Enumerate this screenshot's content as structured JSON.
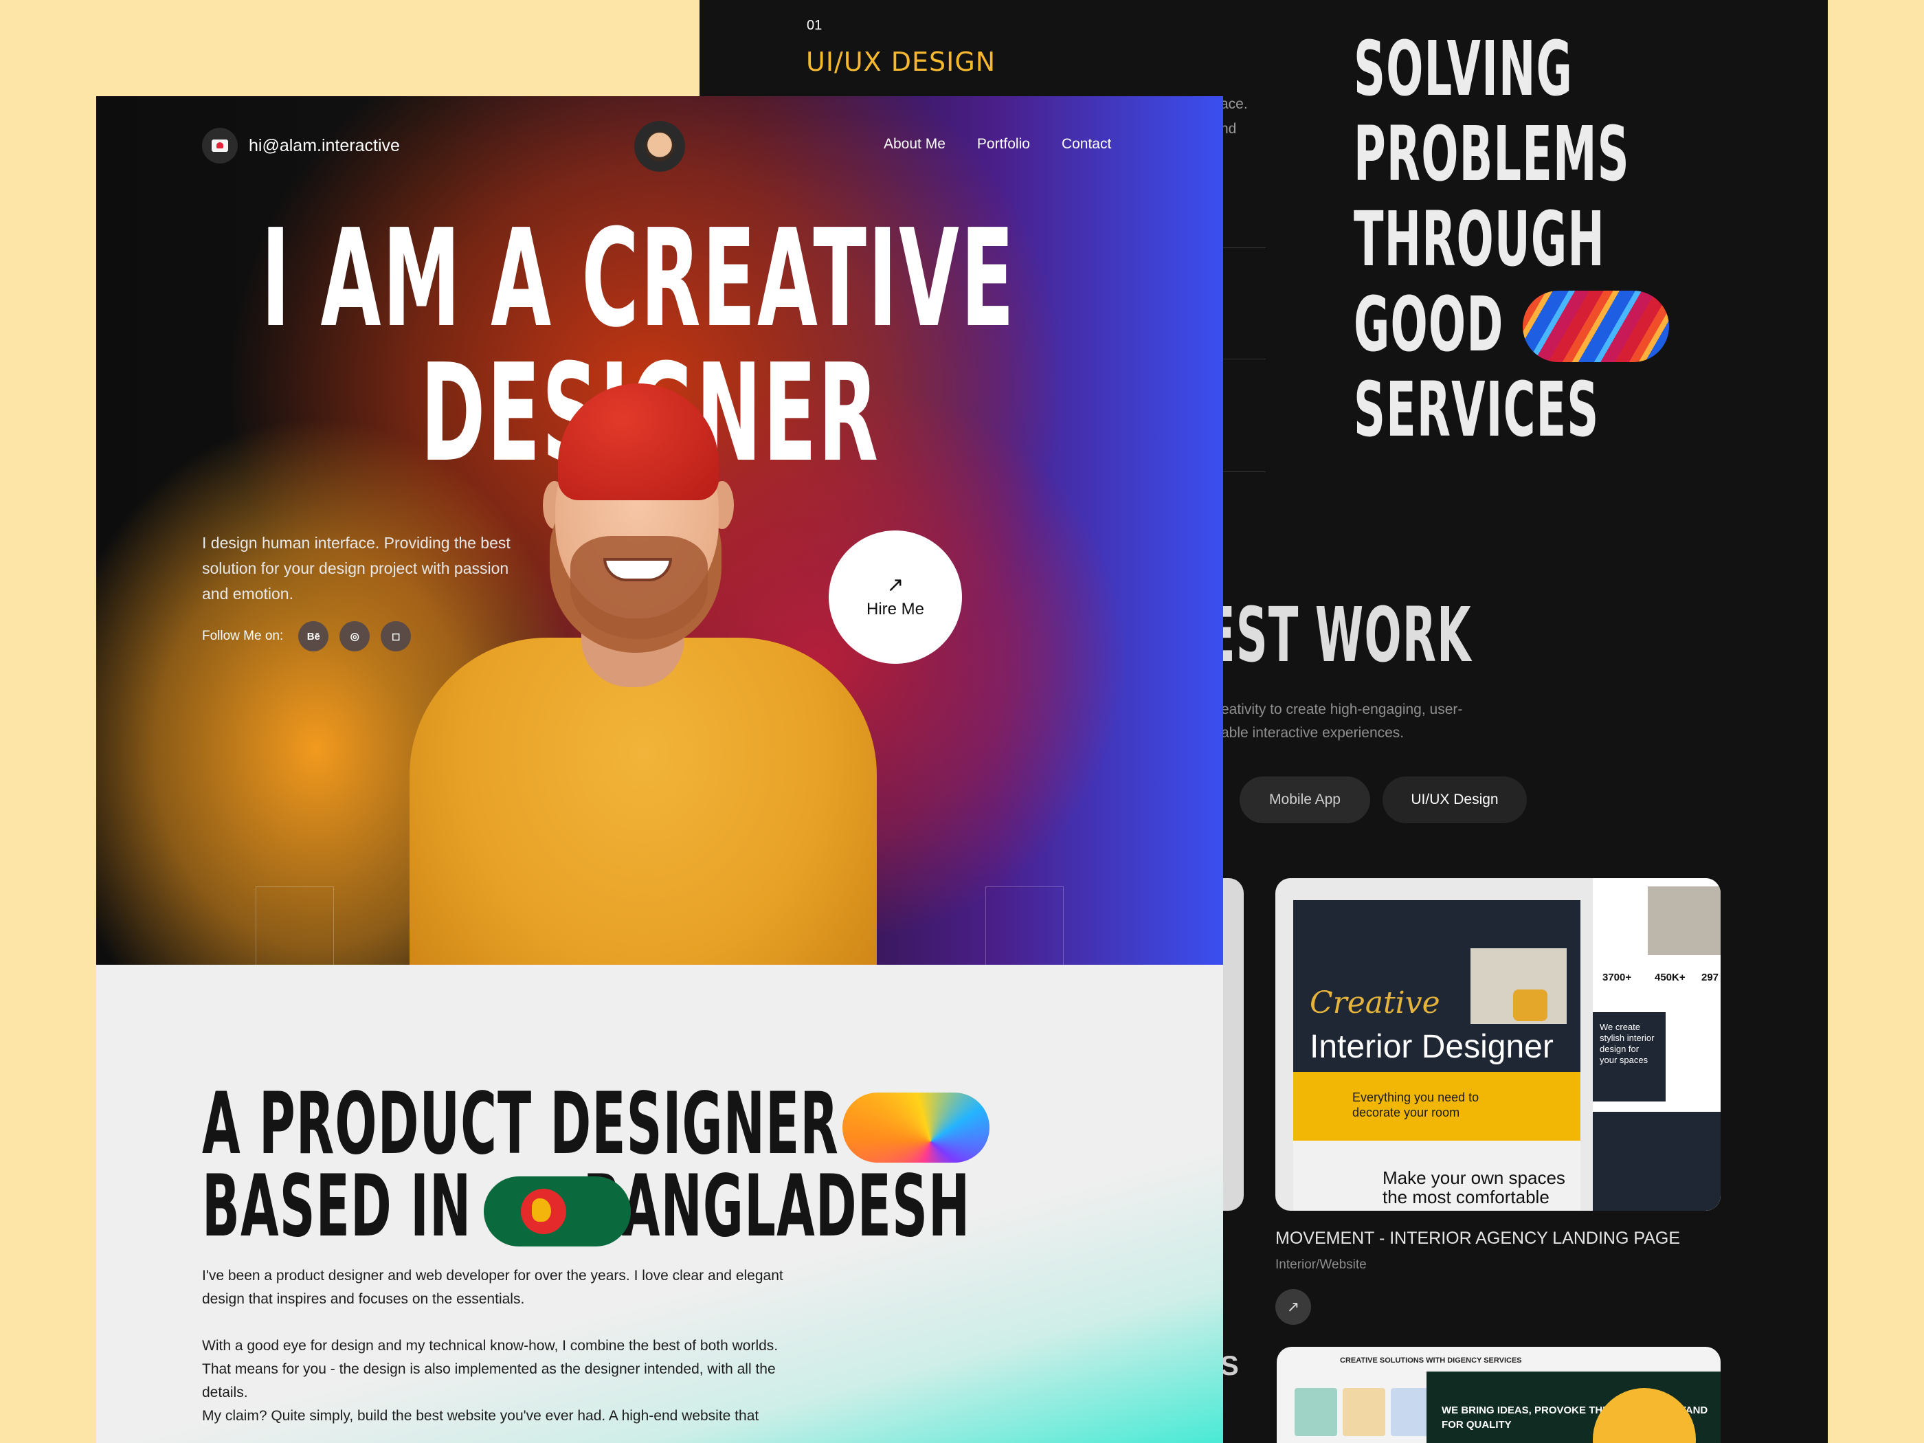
{
  "services": {
    "index": "01",
    "title": "UI/UX DESIGN",
    "fragment_1": "ace.",
    "fragment_2": "nd"
  },
  "tagline": {
    "line1": "SOLVING",
    "line2": "PROBLEMS",
    "line3": "THROUGH",
    "line4": "GOOD",
    "line5": "SERVICES"
  },
  "work": {
    "heading": "EST WORK",
    "desc_line1": "reativity to create high-engaging, user-",
    "desc_line2": "rable interactive experiences.",
    "filters": [
      "Mobile App",
      "UI/UX Design"
    ],
    "project_title": "MOVEMENT - INTERIOR AGENCY LANDING PAGE",
    "project_category": "Interior/Website",
    "arrow_icon": "↗",
    "mock": {
      "creative": "Creative",
      "interior_designer": "Interior Designer",
      "yellow_text": "Everything you need to decorate your room",
      "light_text": "Make your own spaces the most comfortable",
      "stat_1": "3700+",
      "stat_2": "450K+",
      "stat_3": "297",
      "side_text": "We create stylish interior design for your spaces"
    },
    "next_mock": {
      "header": "CREATIVE SOLUTIONS WITH DIGENCY SERVICES",
      "dark_text": "WE BRING IDEAS, PROVOKE THE CHANGE, & STAND FOR QUALITY"
    },
    "edge_letter": "S"
  },
  "nav": {
    "email": "hi@alam.interactive",
    "links": [
      "About Me",
      "Portfolio",
      "Contact"
    ]
  },
  "hero": {
    "headline_line1": "I AM A CREATIVE",
    "headline_line2": "DESIGNER",
    "description": "I design human interface. Providing the best solution for your design project with passion and emotion.",
    "follow_label": "Follow Me on:",
    "social": [
      "Bē",
      "◎",
      "◻"
    ],
    "hire_label": "Hire Me",
    "hire_icon": "↗"
  },
  "about": {
    "title_line1": "A PRODUCT DESIGNER",
    "title_line2_a": "BASED IN",
    "title_line2_b": "BANGLADESH",
    "para1": "I've been a product designer and web developer for over the years. I love clear and elegant design that inspires and focuses on the essentials.",
    "para2": "With a good eye for design and my technical know-how, I combine the best of both worlds. That means for you - the design is also implemented as the designer intended, with all the details.",
    "para3": "My claim? Quite simply, build the best website you've ever had. A high-end website that"
  },
  "colors": {
    "page_bg": "#fde5a7",
    "accent_yellow": "#f5b82e",
    "dark": "#121212"
  }
}
